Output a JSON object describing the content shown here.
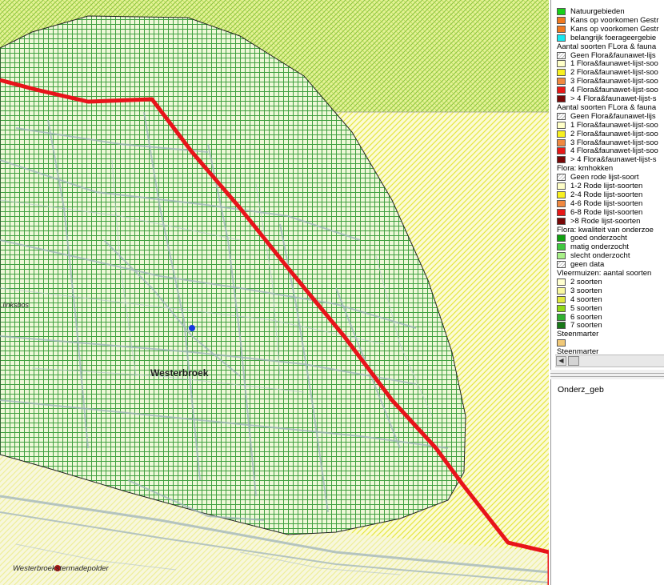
{
  "map": {
    "labels": {
      "place": "Westerbroek",
      "forest": "...linksbos",
      "polder": "Westerbroekstermadepolder"
    },
    "colors": {
      "green_hatch": "#3fa03f",
      "yellow_hatch": "#e6e640",
      "lightgreen_fill": "#eaf7c8",
      "yellow_fill": "#fbfbd0",
      "boundary": "#e8131a",
      "marker": "#1638e0",
      "marker2": "#b01818"
    }
  },
  "legend": {
    "items": [
      {
        "type": "item",
        "label": "Natuurgebieden",
        "color": "#18d018"
      },
      {
        "type": "item",
        "label": "Kans op voorkomen Gestr",
        "color": "#f07820"
      },
      {
        "type": "item",
        "label": "Kans op voorkomen Gestr",
        "color": "#f07820"
      },
      {
        "type": "item",
        "label": "belangrijk foerageergebie",
        "color": "#18e8f0"
      },
      {
        "type": "header",
        "label": "Aantal soorten FLora & fauna"
      },
      {
        "type": "item",
        "label": "Geen Flora&faunawet-lijs",
        "color": "#ffffff",
        "hatch": true
      },
      {
        "type": "item",
        "label": "1 Flora&faunawet-lijst-soo",
        "color": "#ffffc8"
      },
      {
        "type": "item",
        "label": "2 Flora&faunawet-lijst-soo",
        "color": "#f8f020"
      },
      {
        "type": "item",
        "label": "3 Flora&faunawet-lijst-soo",
        "color": "#f08840"
      },
      {
        "type": "item",
        "label": "4 Flora&faunawet-lijst-soo",
        "color": "#e81818"
      },
      {
        "type": "item",
        "label": "> 4 Flora&faunawet-lijst-s",
        "color": "#780808"
      },
      {
        "type": "header",
        "label": "Aantal soorten FLora & fauna"
      },
      {
        "type": "item",
        "label": "Geen Flora&faunawet-lijs",
        "color": "#ffffff",
        "hatch": true
      },
      {
        "type": "item",
        "label": "1 Flora&faunawet-lijst-soo",
        "color": "#ffffc8"
      },
      {
        "type": "item",
        "label": "2 Flora&faunawet-lijst-soo",
        "color": "#f8f020"
      },
      {
        "type": "item",
        "label": "3 Flora&faunawet-lijst-soo",
        "color": "#f08840"
      },
      {
        "type": "item",
        "label": "4 Flora&faunawet-lijst-soo",
        "color": "#e81818"
      },
      {
        "type": "item",
        "label": "> 4 Flora&faunawet-lijst-s",
        "color": "#780808"
      },
      {
        "type": "header",
        "label": "Flora: kmhokken"
      },
      {
        "type": "item",
        "label": "Geen rode lijst-soort",
        "color": "#ffffff",
        "hatch": true
      },
      {
        "type": "item",
        "label": "1-2 Rode lijst-soorten",
        "color": "#ffffc8"
      },
      {
        "type": "item",
        "label": "2-4 Rode lijst-soorten",
        "color": "#f8f020"
      },
      {
        "type": "item",
        "label": "4-6 Rode lijst-soorten",
        "color": "#f08840"
      },
      {
        "type": "item",
        "label": "6-8 Rode lijst-soorten",
        "color": "#e81818"
      },
      {
        "type": "item",
        "label": ">8 Rode lijst-soorten",
        "color": "#780808"
      },
      {
        "type": "header",
        "label": "Flora: kwaliteit van onderzoe"
      },
      {
        "type": "item",
        "label": "goed onderzocht",
        "color": "#10a010"
      },
      {
        "type": "item",
        "label": "matig onderzocht",
        "color": "#40c840"
      },
      {
        "type": "item",
        "label": "slecht onderzocht",
        "color": "#a8f088"
      },
      {
        "type": "item",
        "label": "geen data",
        "color": "#ffffff",
        "hatch": true
      },
      {
        "type": "header",
        "label": "Vleermuizen: aantal soorten"
      },
      {
        "type": "item",
        "label": "2 soorten",
        "color": "#ffffd0"
      },
      {
        "type": "item",
        "label": "3 soorten",
        "color": "#f8f8a0"
      },
      {
        "type": "item",
        "label": "4 soorten",
        "color": "#e0e840"
      },
      {
        "type": "item",
        "label": "5 soorten",
        "color": "#90d818"
      },
      {
        "type": "item",
        "label": "6 soorten",
        "color": "#30b030"
      },
      {
        "type": "item",
        "label": "7 soorten",
        "color": "#187818"
      },
      {
        "type": "header",
        "label": "Steenmarter"
      },
      {
        "type": "item",
        "label": "",
        "color": "#f0c878"
      },
      {
        "type": "header",
        "label": "Steenmarter"
      }
    ]
  },
  "info_panel": {
    "title": "Onderz_geb"
  },
  "scrollbar": {
    "left_arrow": "◀"
  }
}
